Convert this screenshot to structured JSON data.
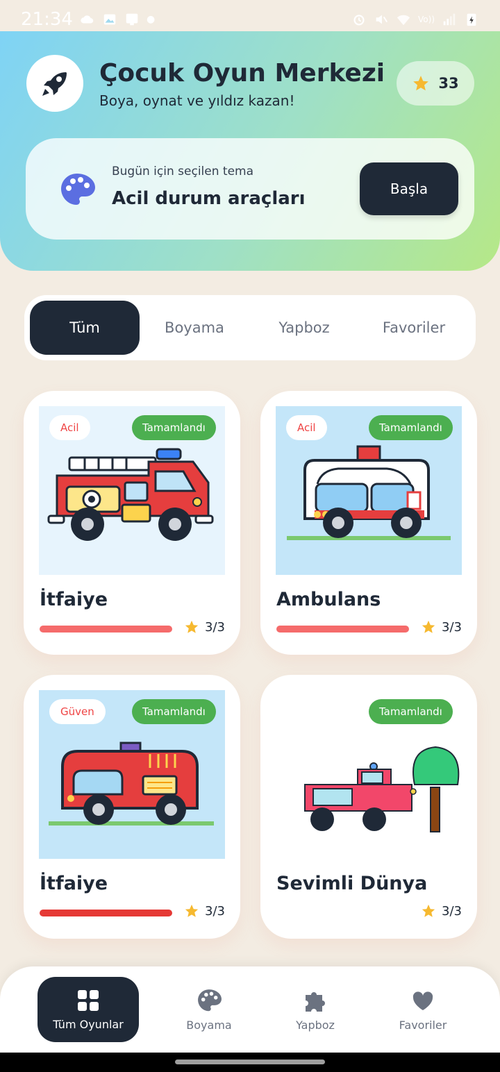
{
  "status_bar": {
    "time": "21:34",
    "carrier": "Vo))"
  },
  "header": {
    "title": "Çocuk Oyun Merkezi",
    "subtitle": "Boya, oynat ve yıldız kazan!",
    "stars": "33",
    "theme_label": "Bugün için seçilen tema",
    "theme_value": "Acil durum araçları",
    "start_button": "Başla"
  },
  "tabs": [
    {
      "label": "Tüm",
      "active": true
    },
    {
      "label": "Boyama",
      "active": false
    },
    {
      "label": "Yapboz",
      "active": false
    },
    {
      "label": "Favoriler",
      "active": false
    }
  ],
  "cards": [
    {
      "title": "İtfaiye",
      "category": "Acil",
      "status": "Tamamlandı",
      "stars": "3/3",
      "progress": 1.0
    },
    {
      "title": "Ambulans",
      "category": "Acil",
      "status": "Tamamlandı",
      "stars": "3/3",
      "progress": 1.0
    },
    {
      "title": "İtfaiye",
      "category": "Güven",
      "status": "Tamamlandı",
      "stars": "3/3",
      "progress": 1.0
    },
    {
      "title": "Sevimli Dünya",
      "category": "",
      "status": "Tamamlandı",
      "stars": "3/3"
    }
  ],
  "bottom_nav": [
    {
      "label": "Tüm Oyunlar",
      "icon": "grid-icon",
      "active": true
    },
    {
      "label": "Boyama",
      "icon": "palette-icon",
      "active": false
    },
    {
      "label": "Yapboz",
      "icon": "puzzle-icon",
      "active": false
    },
    {
      "label": "Favoriler",
      "icon": "heart-icon",
      "active": false
    }
  ],
  "colors": {
    "dark": "#1f2937",
    "done_green": "#4caf50",
    "progress_red": "#f56b6b",
    "star": "#f6b930"
  }
}
